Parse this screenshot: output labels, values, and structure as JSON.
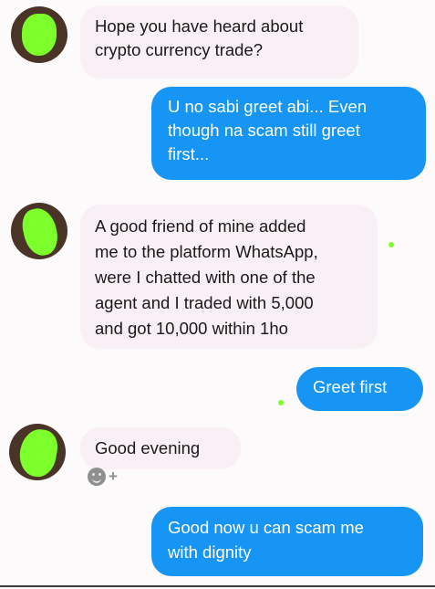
{
  "messages": [
    {
      "from": "other",
      "text": "Hope you have heard about\ncrypto currency trade?"
    },
    {
      "from": "me",
      "text": "U no sabi greet abi... Even\nthough na scam still greet\nfirst..."
    },
    {
      "from": "other",
      "text": "A good friend of mine added\nme to the platform WhatsApp,\nwere I chatted with one of the\nagent and I traded with 5,000\nand got 10,000  within 1ho"
    },
    {
      "from": "me",
      "text": "Greet first"
    },
    {
      "from": "other",
      "text": "Good evening"
    },
    {
      "from": "me",
      "text": "Good now u can scam me\nwith dignity"
    }
  ],
  "reaction": {
    "plus": "+",
    "icon": "smiley-icon"
  },
  "colors": {
    "outgoing": "#1695f5",
    "incoming": "#f9f0f6",
    "censor": "#7dff2b"
  }
}
